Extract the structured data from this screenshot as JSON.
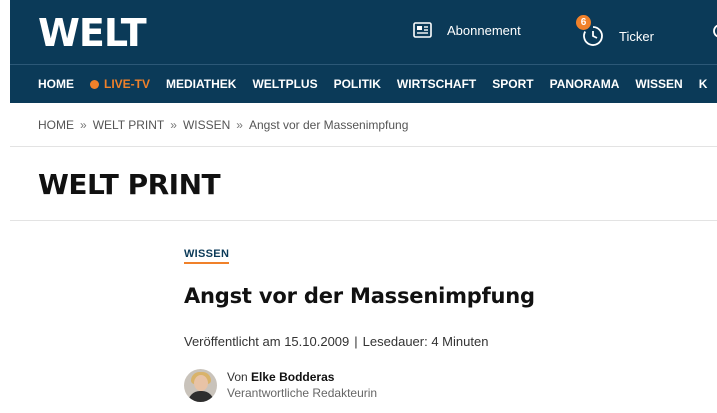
{
  "header": {
    "logo": "WELT",
    "abonnement_label": "Abonnement",
    "ticker_label": "Ticker",
    "ticker_badge": "6"
  },
  "nav": {
    "items": [
      "HOME",
      "LIVE-TV",
      "MEDIATHEK",
      "WELTPLUS",
      "POLITIK",
      "WIRTSCHAFT",
      "SPORT",
      "PANORAMA",
      "WISSEN",
      "K"
    ]
  },
  "breadcrumb": [
    "HOME",
    "WELT PRINT",
    "WISSEN",
    "Angst vor der Massenimpfung"
  ],
  "breadcrumb_separator": "»",
  "section_title": "WELT PRINT",
  "article": {
    "kicker": "WISSEN",
    "headline": "Angst vor der Massenimpfung",
    "published": "Veröffentlicht am 15.10.2009",
    "meta_separator": "|",
    "reading_time": "Lesedauer: 4 Minuten",
    "author_prefix": "Von",
    "author_name": "Elke Bodderas",
    "author_role": "Verantwortliche Redakteurin"
  },
  "colors": {
    "brand_blue": "#0b3a58",
    "accent_orange": "#f0812a"
  }
}
